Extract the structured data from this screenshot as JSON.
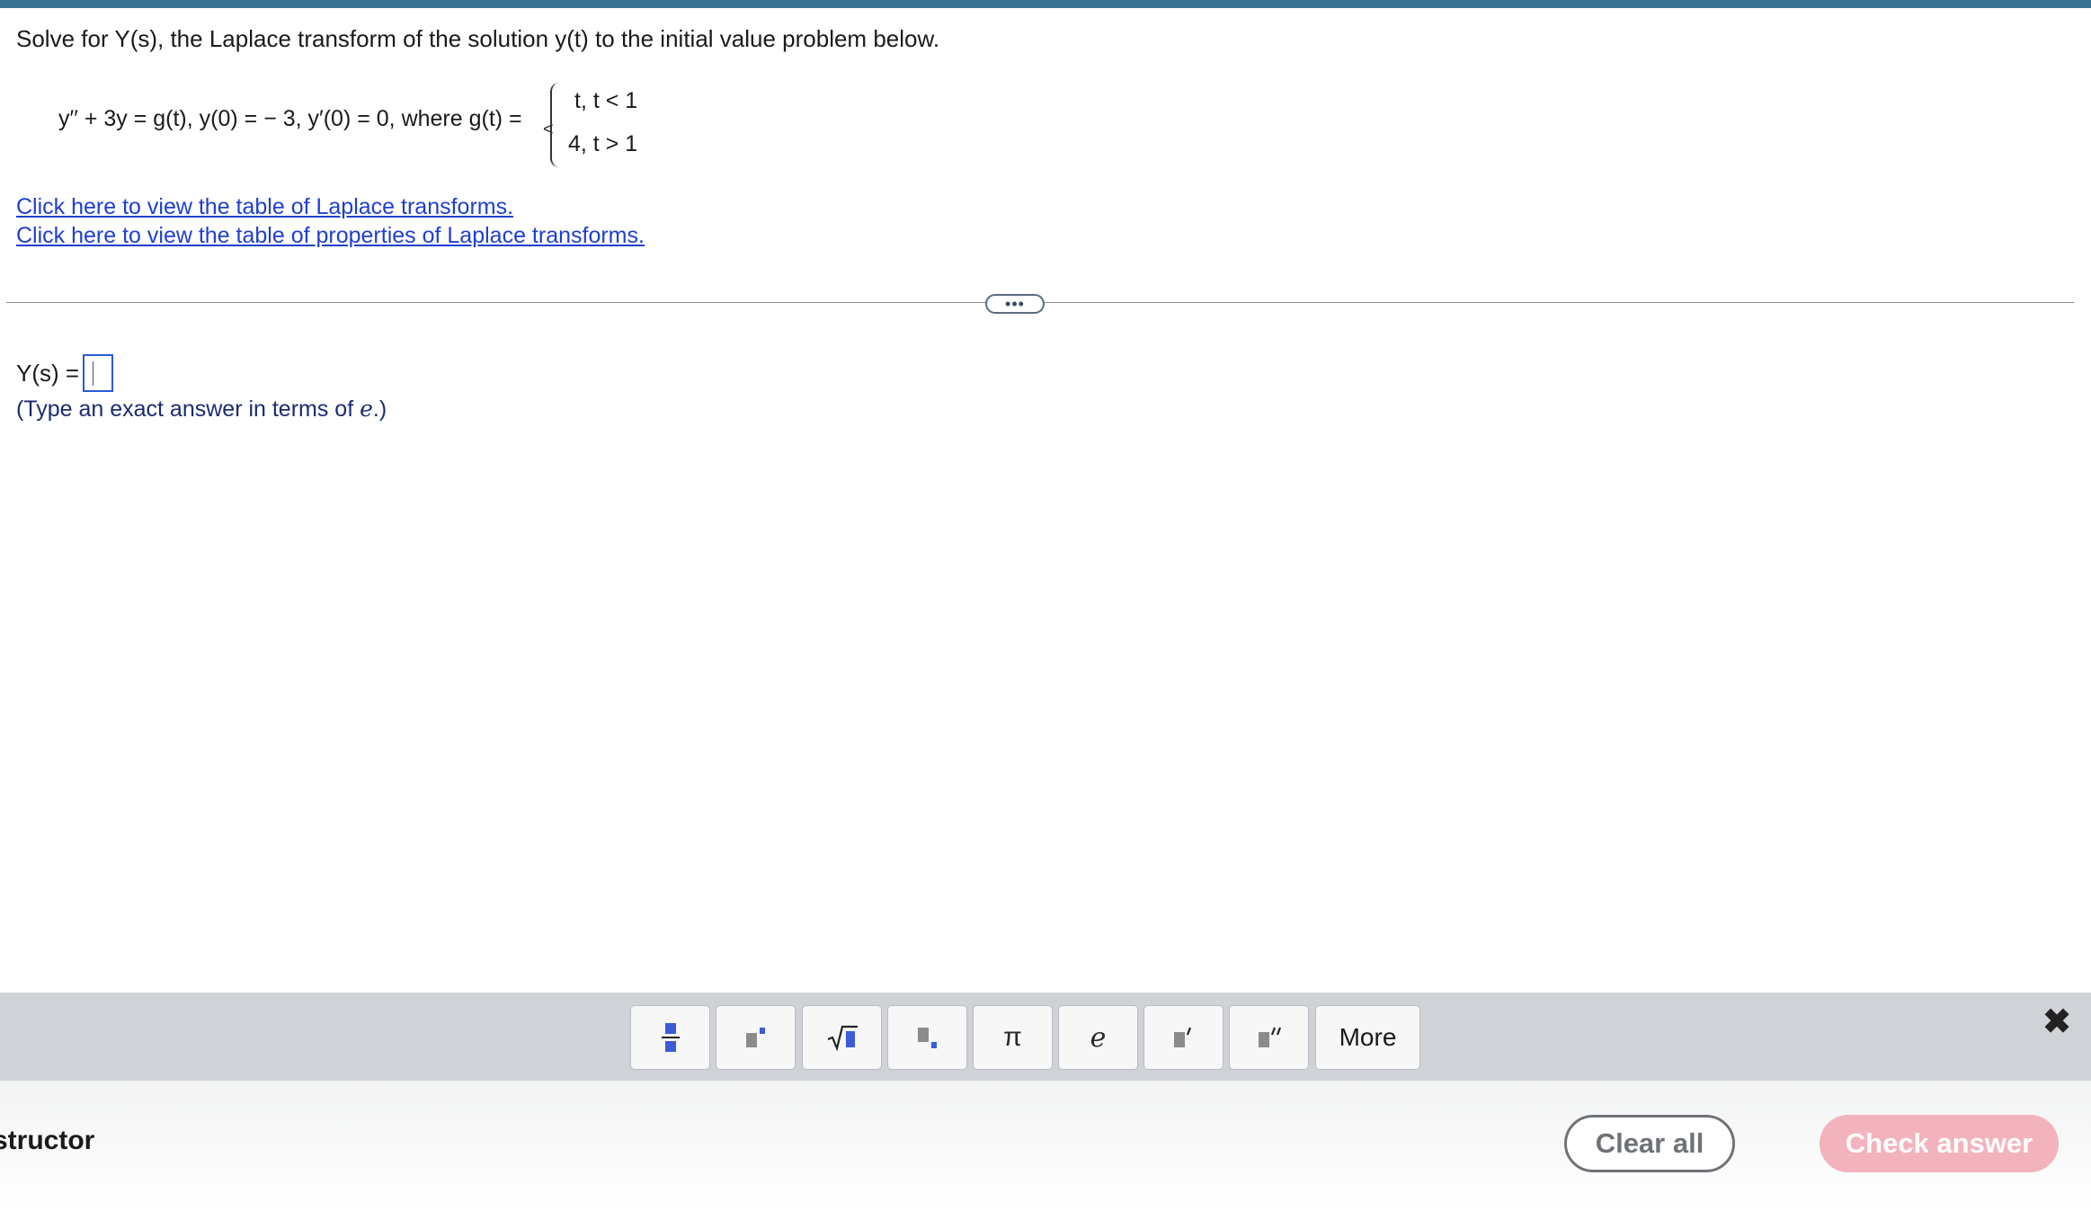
{
  "question": {
    "prompt": "Solve for Y(s), the Laplace transform of the solution y(t) to the initial value problem below.",
    "equation": "y′′ + 3y = g(t),  y(0) =  − 3,  y′(0) = 0,  where g(t) = ",
    "cases": [
      "t,  t < 1",
      "4,  t > 1"
    ],
    "links": [
      "Click here to view the table of Laplace transforms.",
      "Click here to view the table of properties of Laplace transforms."
    ]
  },
  "divider": {
    "more_label": "•••"
  },
  "answer": {
    "label": "Y(s) =",
    "value": "",
    "hint_prefix": "(Type an exact answer in terms of ",
    "hint_var": "e",
    "hint_suffix": ".)"
  },
  "palette": {
    "buttons": [
      {
        "name": "fraction-button",
        "icon": "fraction-icon"
      },
      {
        "name": "exponent-button",
        "icon": "exponent-icon"
      },
      {
        "name": "sqrt-button",
        "icon": "sqrt-icon"
      },
      {
        "name": "subscript-button",
        "icon": "subscript-icon"
      },
      {
        "name": "pi-button",
        "label": "π"
      },
      {
        "name": "e-button",
        "label": "e"
      },
      {
        "name": "prime-button",
        "icon": "prime-icon"
      },
      {
        "name": "double-prime-button",
        "icon": "double-prime-icon"
      },
      {
        "name": "more-button",
        "label": "More"
      }
    ],
    "close_label": "✖"
  },
  "footer": {
    "instructor_label": "structor",
    "clear_label": "Clear all",
    "check_label": "Check answer"
  },
  "colors": {
    "topbar": "#3a7391",
    "link": "#1e3fd0",
    "answer_box_border": "#2a5bd7",
    "palette_bg": "#cfd2d7",
    "check_button": "#f2b3bd"
  }
}
